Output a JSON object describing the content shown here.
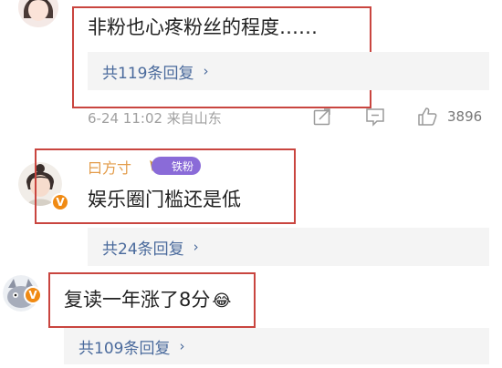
{
  "comments": [
    {
      "text": "非粉也心疼粉丝的程度……",
      "replies_label": "共119条回复",
      "meta": "6-24 11:02 来自山东",
      "like_count": "3896"
    },
    {
      "username": "曰方寸",
      "badge": "铁粉",
      "text": "娱乐圈门槛还是低",
      "replies_label": "共24条回复"
    },
    {
      "text": "复读一年涨了8分",
      "replies_label": "共109条回复"
    }
  ],
  "icons": {
    "chevron": "›",
    "verified": "V",
    "emoji": "😂"
  },
  "colors": {
    "highlight": "#c9453f",
    "reply_link": "#4a6a9c",
    "verified_badge": "#f08a13",
    "fan_badge": "#8a6bd8"
  }
}
